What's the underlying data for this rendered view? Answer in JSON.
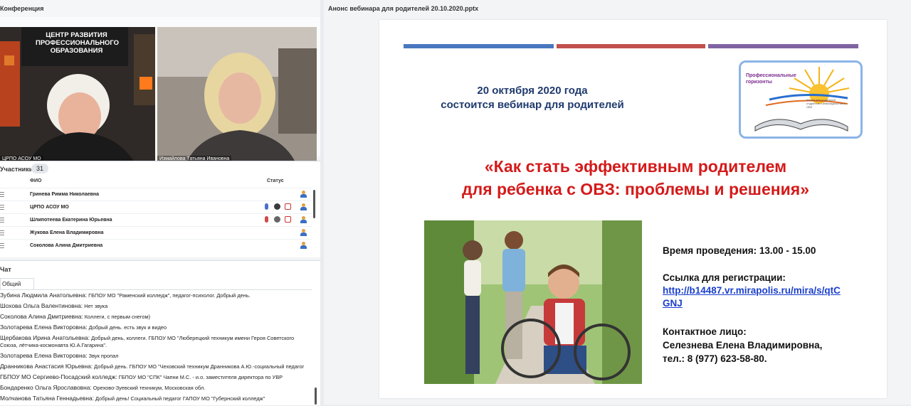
{
  "conference": {
    "title": "Конференция",
    "participants": [
      {
        "name": "ЦРПО АСОУ МО",
        "scene_text": "ЦЕНТР РАЗВИТИЯ ПРОФЕССИОНАЛЬНОГО ОБРАЗОВАНИЯ"
      },
      {
        "name": "Измайлова Татьяна Ивановна"
      }
    ]
  },
  "participants_panel": {
    "title": "Участники",
    "count": "31",
    "col_name": "ФИО",
    "col_status": "Статус",
    "rows": [
      {
        "name": "Гринева Римма Николаевна"
      },
      {
        "name": "ЦРПО АСОУ МО"
      },
      {
        "name": "Шлипотеева Екатерина Юрьевна"
      },
      {
        "name": "Жукова  Елена  Владимировна"
      },
      {
        "name": "Соколова Алина  Дмитриевна"
      }
    ]
  },
  "chat": {
    "title": "Чат",
    "tab": "Общий",
    "messages": [
      {
        "author": "Зубина Людмила Анатольевна:",
        "text": "ГБПОУ МО \"Раменский колледж\", педагог-психолог. Добрый день."
      },
      {
        "author": "Шохова  Ольга  Валентиновна:",
        "text": "Нет звука"
      },
      {
        "author": "Соколова Алина  Дмитриевна:",
        "text": "Коллеги, с первым снегом)"
      },
      {
        "author": "Золотарева Елена Викторовна:",
        "text": "Добрый день. есть звук и видео"
      },
      {
        "author": "Щербакова Ирина Анатольевна:",
        "text": "Добрый день, коллеги. ГБПОУ МО \"Люберецкий техникум имени Героя Советского Союза, лётчика-космонавта Ю.А.Гагарина\"."
      },
      {
        "author": "Золотарева Елена Викторовна:",
        "text": "Звук пропал"
      },
      {
        "author": "Дранникова Анастасия Юрьевна:",
        "text": "Добрый день. ГБПОУ МО \"Чеховский техникум Дранникова А.Ю.-социальный педагог"
      },
      {
        "author": "ГБПОУ МО Сергиево-Посадский колледж:",
        "text": "ГБПОУ МО \"СПК\" Чапни М.С. - и.о. заместителя директора по УВР"
      },
      {
        "author": "Бондаренко Ольга Ярославовна:",
        "text": "Орехово-Зуевский техникум, Московская обл."
      },
      {
        "author": "Молчанова Татьяна Геннадьевна:",
        "text": "Добрый день! Социальный педагог ГАПОУ МО \"Губернский колледж\""
      }
    ]
  },
  "presentation": {
    "title": "Анонс вебинара для родителей  20.10.2020.pptx",
    "slide": {
      "date_line1": "20 октября 2020 года",
      "date_line2": "состоится  вебинар для родителей",
      "logo_title": "Профессиональные горизонты",
      "logo_sub": "Школа для родителей студентов с инвалидностью и ОВЗ",
      "topic_line1": "«Как стать эффективным родителем",
      "topic_line2": "для ребенка с ОВЗ: проблемы и решения»",
      "time": "Время проведения:  13.00  - 15.00",
      "link_label": "Ссылка для регистрации:",
      "link_1": "http://b14487.vr.mirapolis.ru/mira/s/qtC",
      "link_2": "GNJ",
      "contact_label": "Контактное лицо:",
      "contact_name": "Селезнева Елена Владимировна,",
      "contact_phone": "тел.: 8 (977) 623-58-80."
    }
  },
  "colors": {
    "bar_blue": "#4a78c0",
    "bar_red": "#c0504d",
    "bar_purple": "#8064a2",
    "topic_red": "#d41a1a",
    "date_navy": "#1f3a6e"
  }
}
